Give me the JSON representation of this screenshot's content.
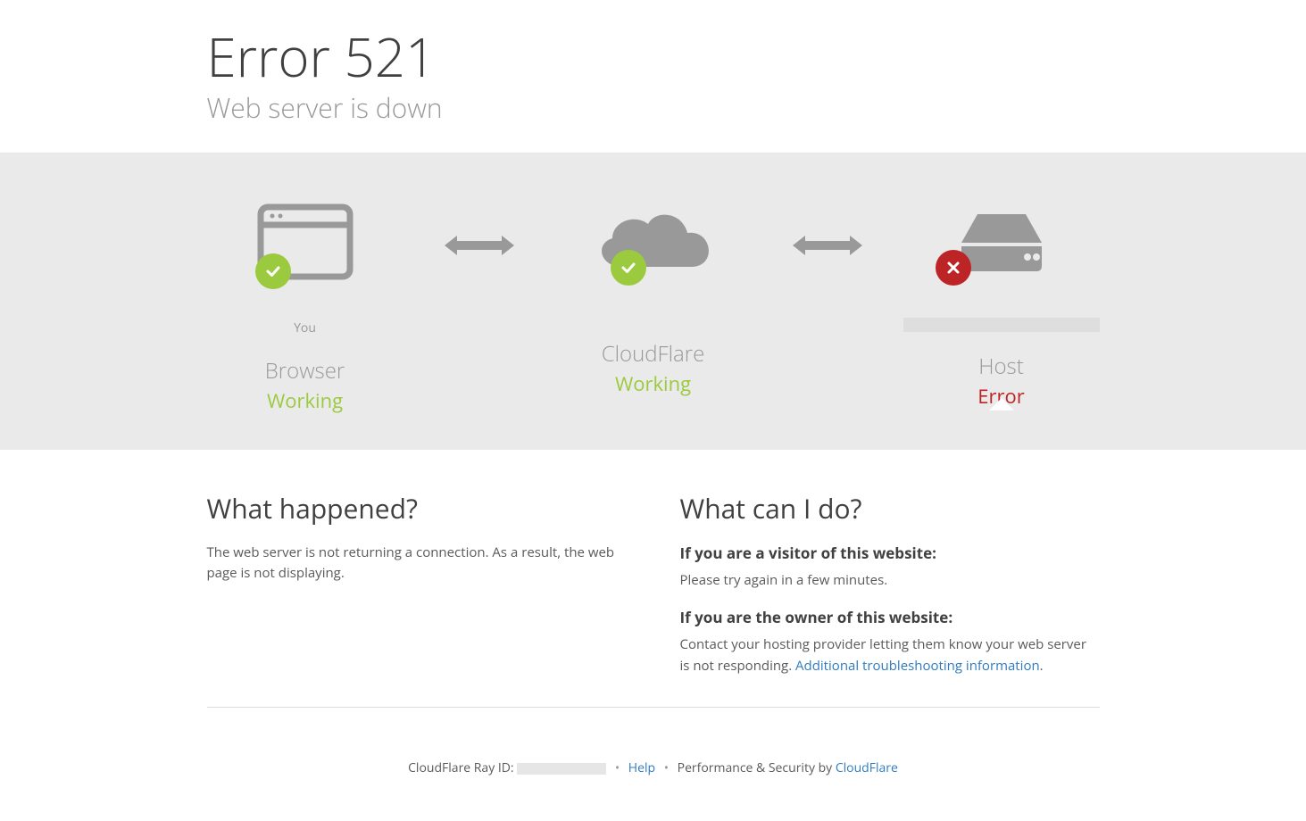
{
  "header": {
    "title": "Error 521",
    "subtitle": "Web server is down"
  },
  "status": {
    "you_label": "You",
    "browser": {
      "title": "Browser",
      "status": "Working"
    },
    "cloudflare": {
      "title": "CloudFlare",
      "status": "Working"
    },
    "host": {
      "title": "Host",
      "status": "Error"
    }
  },
  "info": {
    "happened_heading": "What happened?",
    "happened_body": "The web server is not returning a connection. As a result, the web page is not displaying.",
    "cando_heading": "What can I do?",
    "visitor_heading": "If you are a visitor of this website:",
    "visitor_body": "Please try again in a few minutes.",
    "owner_heading": "If you are the owner of this website:",
    "owner_body_prefix": "Contact your hosting provider letting them know your web server is not responding. ",
    "owner_link_text": "Additional troubleshooting information",
    "owner_body_suffix": "."
  },
  "footer": {
    "ray_label": "CloudFlare Ray ID: ",
    "help_link": "Help",
    "perf_label": "Performance & Security by ",
    "cf_link": "CloudFlare"
  },
  "colors": {
    "ok": "#9bca3e",
    "err": "#bd2426"
  }
}
